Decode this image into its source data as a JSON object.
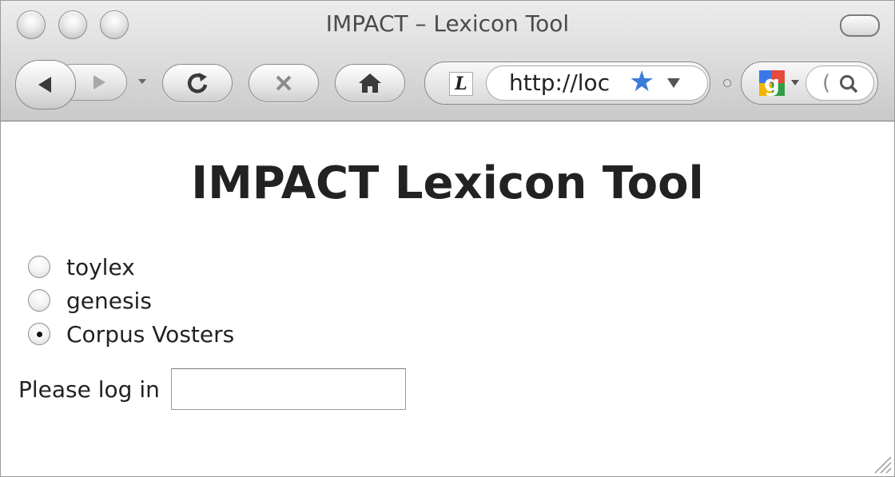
{
  "window": {
    "title": "IMPACT – Lexicon Tool"
  },
  "toolbar": {
    "url": "http://loc",
    "search_placeholder": "(",
    "icons": [
      "back-icon",
      "forward-icon",
      "reload-icon",
      "stop-icon",
      "home-icon",
      "bookmark-star-icon",
      "google-icon",
      "search-icon"
    ]
  },
  "page": {
    "heading": "IMPACT Lexicon Tool",
    "options": [
      {
        "label": "toylex",
        "checked": false
      },
      {
        "label": "genesis",
        "checked": false
      },
      {
        "label": "Corpus Vosters",
        "checked": true
      }
    ],
    "login_label": "Please log in",
    "login_value": ""
  }
}
